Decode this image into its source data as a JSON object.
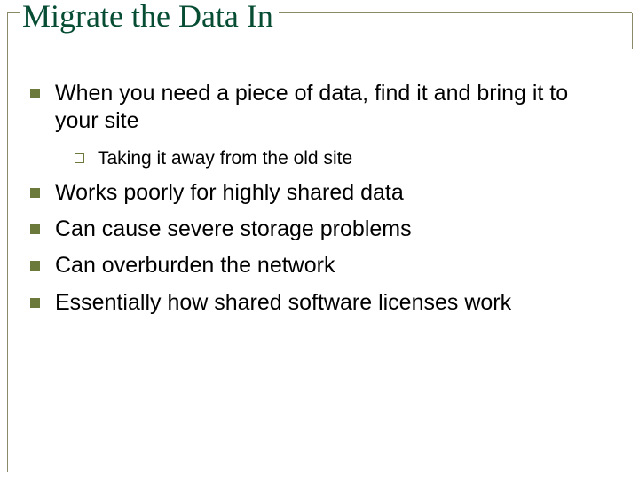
{
  "title": "Migrate the Data In",
  "bullets": {
    "b0": "When you need a piece of data, find it and bring it to your site",
    "b0_sub0": "Taking it away from the old site",
    "b1": "Works poorly for highly shared data",
    "b2": "Can cause severe storage problems",
    "b3": "Can overburden the network",
    "b4": "Essentially how shared software licenses work"
  }
}
